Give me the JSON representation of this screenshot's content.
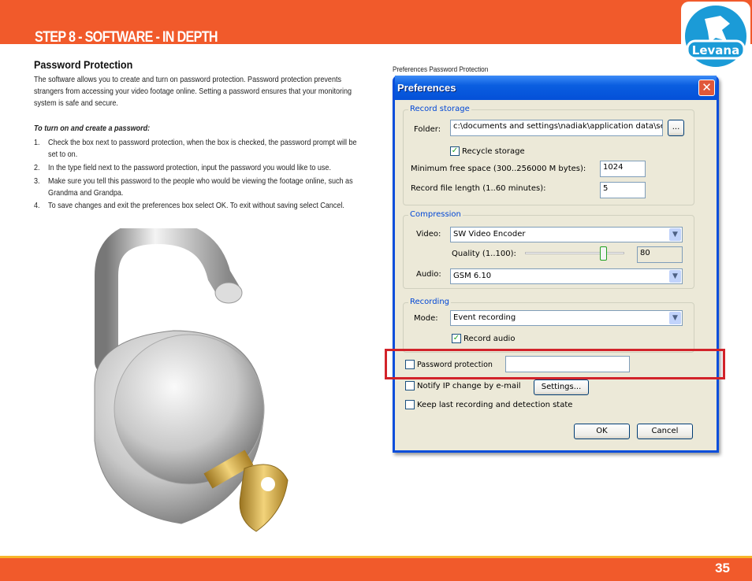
{
  "header": {
    "title": "STEP 8  - SOFTWARE - IN DEPTH",
    "logo_text": "Levana",
    "page_number": "35"
  },
  "section": {
    "heading": "Password Protection",
    "intro": "The software allows you to create and turn on password protection. Password protection prevents strangers from accessing your video footage online. Setting a password ensures that your monitoring system is safe and secure.",
    "subheading": "To turn on and create a password:",
    "steps": [
      {
        "n": "1.",
        "text": "Check the box next to password protection, when the box is checked, the password prompt will be set to on."
      },
      {
        "n": "2.",
        "text": "In the type field next to the password protection, input the password you would like to use."
      },
      {
        "n": "3.",
        "text": "Make sure you tell this password to the people who would be viewing the footage online, such as Grandma and Grandpa."
      },
      {
        "n": "4.",
        "text": "To save changes and exit the preferences box select OK. To exit without saving select Cancel."
      }
    ]
  },
  "figure": {
    "caption": "Preferences Password Protection"
  },
  "dialog": {
    "title": "Preferences",
    "record_storage": {
      "legend": "Record storage",
      "folder_label": "Folder:",
      "folder_value": "c:\\documents and settings\\nadiak\\application data\\secu",
      "browse": "...",
      "recycle_label": "Recycle storage",
      "recycle_checked": true,
      "min_space_label": "Minimum free space (300..256000 M bytes):",
      "min_space_value": "1024",
      "file_length_label": "Record file length (1..60 minutes):",
      "file_length_value": "5"
    },
    "compression": {
      "legend": "Compression",
      "video_label": "Video:",
      "video_value": "SW Video Encoder",
      "quality_label": "Quality (1..100):",
      "quality_value": "80",
      "audio_label": "Audio:",
      "audio_value": "GSM 6.10"
    },
    "recording": {
      "legend": "Recording",
      "mode_label": "Mode:",
      "mode_value": "Event recording",
      "record_audio_label": "Record audio",
      "record_audio_checked": true
    },
    "password_label": "Password protection",
    "password_value": "",
    "notify_label": "Notify IP change by e-mail",
    "settings_button": "Settings...",
    "keep_label": "Keep last recording and detection state",
    "ok": "OK",
    "cancel": "Cancel"
  },
  "colors": {
    "accent": "#F15A2B",
    "highlight": "#D2232A",
    "titlebar": "#0A5EE0"
  }
}
